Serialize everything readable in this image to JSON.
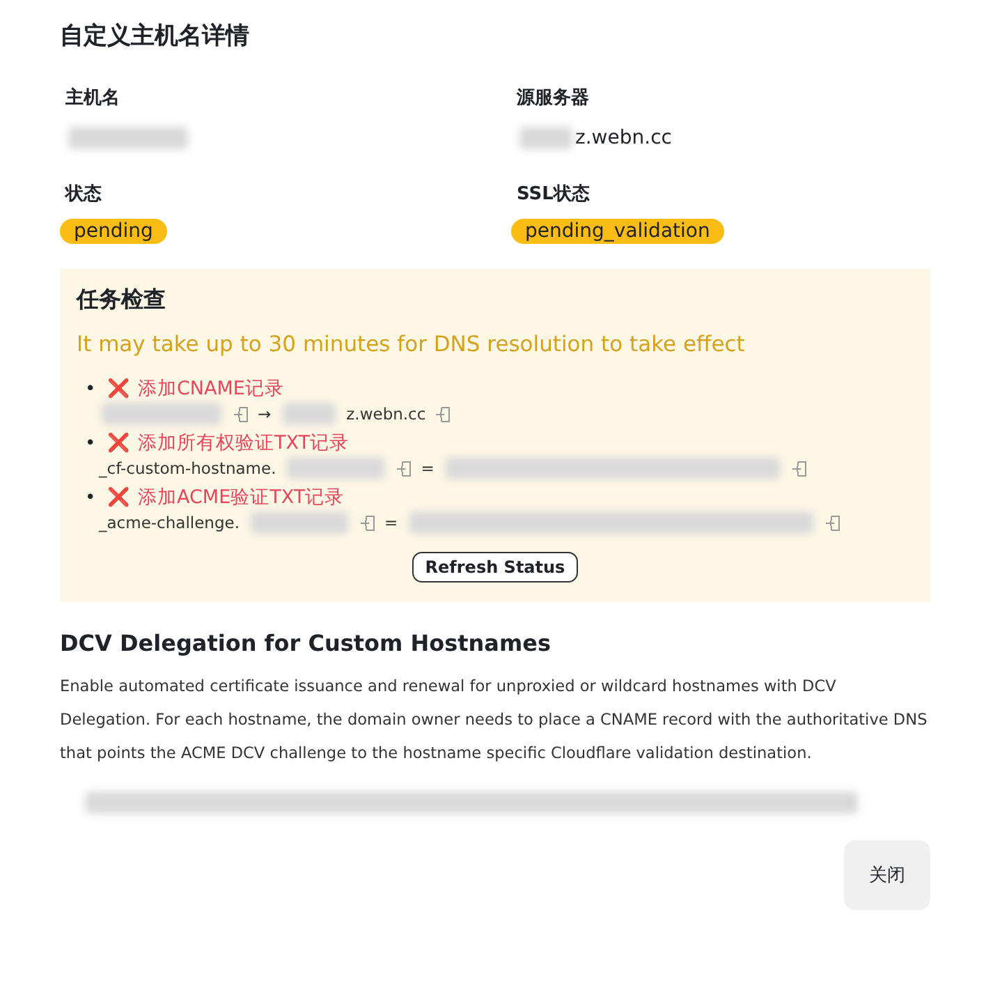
{
  "title": "自定义主机名详情",
  "fields": [
    {
      "label": "主机名",
      "value": [
        {
          "kind": "redacted"
        }
      ]
    },
    {
      "label": "源服务器",
      "value": [
        {
          "kind": "redacted"
        },
        {
          "kind": "text",
          "text": "z.webn.cc"
        }
      ]
    },
    {
      "label": "状态",
      "badge": "pending"
    },
    {
      "label": "SSL状态",
      "badge": "pending_validation"
    }
  ],
  "tasks": {
    "title": "任务检查",
    "notice": "It may take up to 30 minutes for DNS resolution to take effect",
    "items": [
      {
        "bullet": "•",
        "mark": "❌",
        "label": "添加CNAME记录",
        "record": [
          {
            "kind": "redacted"
          },
          {
            "kind": "copy"
          },
          {
            "kind": "text",
            "text": "→"
          },
          {
            "kind": "redacted"
          },
          {
            "kind": "text",
            "text": "z.webn.cc"
          },
          {
            "kind": "copy"
          }
        ]
      },
      {
        "bullet": "•",
        "mark": "❌",
        "label": "添加所有权验证TXT记录",
        "record": [
          {
            "kind": "text",
            "text": "_cf-custom-hostname."
          },
          {
            "kind": "redacted"
          },
          {
            "kind": "copy"
          },
          {
            "kind": "text",
            "text": "="
          },
          {
            "kind": "redacted"
          },
          {
            "kind": "copy"
          }
        ]
      },
      {
        "bullet": "•",
        "mark": "❌",
        "label": "添加ACME验证TXT记录",
        "record": [
          {
            "kind": "text",
            "text": "_acme-challenge."
          },
          {
            "kind": "redacted"
          },
          {
            "kind": "copy"
          },
          {
            "kind": "text",
            "text": "="
          },
          {
            "kind": "redacted"
          },
          {
            "kind": "copy"
          }
        ]
      }
    ],
    "refresh_button": "Refresh Status"
  },
  "dcv": {
    "title": "DCV Delegation for Custom Hostnames",
    "description": "Enable automated certificate issuance and renewal for unproxied or wildcard hostnames with DCV Delegation. For each hostname, the domain owner needs to place a CNAME record with the authoritative DNS that points the ACME DCV challenge to the hostname specific Cloudflare validation destination.",
    "value": [
      {
        "kind": "redacted"
      }
    ]
  },
  "close_button": "关闭"
}
